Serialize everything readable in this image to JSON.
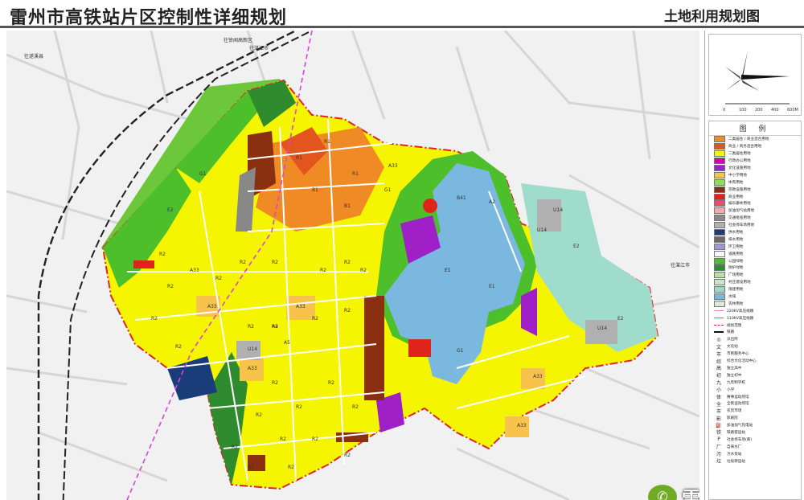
{
  "header": {
    "title": "雷州市高铁站片区控制性详细规划",
    "subtitle": "土地利用规划图"
  },
  "map": {
    "road_labels": {
      "top_center": "往徐闻高新区",
      "top_left": "往遂溪县",
      "top_mid": "往湛江市",
      "right": "往湛江市"
    },
    "parcel_codes": [
      "R2",
      "R2",
      "R2",
      "R2",
      "R2",
      "R2",
      "R2",
      "R2",
      "R2",
      "R2",
      "R2",
      "R2",
      "R2",
      "R2",
      "R2",
      "R2",
      "R2",
      "R2",
      "R2",
      "R2",
      "R2",
      "R2",
      "R2",
      "R2",
      "R2",
      "E1",
      "E1",
      "E2",
      "E2",
      "E2",
      "G1",
      "G1",
      "G1",
      "A33",
      "A33",
      "A33",
      "A33",
      "A33",
      "A33",
      "A33",
      "A4",
      "A5",
      "U14",
      "U14",
      "U14",
      "U14",
      "R1",
      "R1",
      "R1",
      "B1",
      "B1",
      "B41",
      "A2"
    ],
    "lake_label": "E1"
  },
  "north_arrow": {
    "scale_ticks": [
      "0",
      "100",
      "200",
      "400",
      "600M"
    ]
  },
  "legend": {
    "title": "图 例",
    "items": [
      {
        "color": "#f08a24",
        "label": "二类居住 / 商业混合用地"
      },
      {
        "color": "#e2561e",
        "label": "商业 / 商务混合用地"
      },
      {
        "color": "#f5f500",
        "label": "二类居住用地"
      },
      {
        "color": "#c90aa4",
        "label": "行政办公用地"
      },
      {
        "color": "#a020c8",
        "label": "文化设施用地"
      },
      {
        "color": "#f7c34c",
        "label": "中小学用地"
      },
      {
        "color": "#8fdc5a",
        "label": "体育用地"
      },
      {
        "color": "#8a3010",
        "label": "宗教设施用地"
      },
      {
        "color": "#e0241c",
        "label": "商业用地"
      },
      {
        "color": "#e84e6a",
        "label": "娱乐康体用地"
      },
      {
        "color": "#f4a8b0",
        "label": "加油加气站用地"
      },
      {
        "color": "#888888",
        "label": "交通枢纽用地"
      },
      {
        "color": "#b0b0b0",
        "label": "社会停车场用地"
      },
      {
        "color": "#1a3c78",
        "label": "供水用地"
      },
      {
        "color": "#6a6a6a",
        "label": "排水用地"
      },
      {
        "color": "#9a9ad0",
        "label": "环卫用地"
      },
      {
        "color": "#f8f8f8",
        "label": "道路用地"
      },
      {
        "color": "#4cbf2a",
        "label": "公园绿地"
      },
      {
        "color": "#2e8b2e",
        "label": "防护绿地"
      },
      {
        "color": "#b6e0a0",
        "label": "广场用地"
      },
      {
        "color": "#c8e6c8",
        "label": "村庄建设用地"
      },
      {
        "color": "#a0d8c8",
        "label": "限建用地"
      },
      {
        "color": "#7ab8e0",
        "label": "水域"
      },
      {
        "color": "#d8eadc",
        "label": "农林用地"
      }
    ],
    "line_items": [
      {
        "style": "pink",
        "label": "220KV高压线路"
      },
      {
        "style": "purple",
        "label": "110KV高压线路"
      },
      {
        "style": "reddash",
        "label": "规划范围"
      },
      {
        "style": "blackdash",
        "label": "铁路"
      }
    ],
    "symbol_items": [
      {
        "glyph": "◎",
        "label": "派出所"
      },
      {
        "glyph": "文",
        "label": "文化站"
      },
      {
        "glyph": "市",
        "label": "市民服务中心"
      },
      {
        "glyph": "综",
        "label": "综合文化活动中心"
      },
      {
        "glyph": "高",
        "label": "独立高中"
      },
      {
        "glyph": "初",
        "label": "独立初中"
      },
      {
        "glyph": "九",
        "label": "九年制学校"
      },
      {
        "glyph": "小",
        "label": "小学"
      },
      {
        "glyph": "体",
        "label": "赛事运动场馆"
      },
      {
        "glyph": "全",
        "label": "全民运动场馆"
      },
      {
        "glyph": "市",
        "label": "农贸市场"
      },
      {
        "glyph": "影",
        "label": "影剧院"
      },
      {
        "glyph": "⛽",
        "label": "加油加气充电站"
      },
      {
        "glyph": "铁",
        "label": "铁路客运站"
      },
      {
        "glyph": "P",
        "label": "社会停车场(库)"
      },
      {
        "glyph": "厂",
        "label": "自来水厂"
      },
      {
        "glyph": "污",
        "label": "污水泵站"
      },
      {
        "glyph": "垃",
        "label": "垃圾转运站"
      }
    ]
  },
  "watermark": {
    "text": "雷州万年城"
  }
}
